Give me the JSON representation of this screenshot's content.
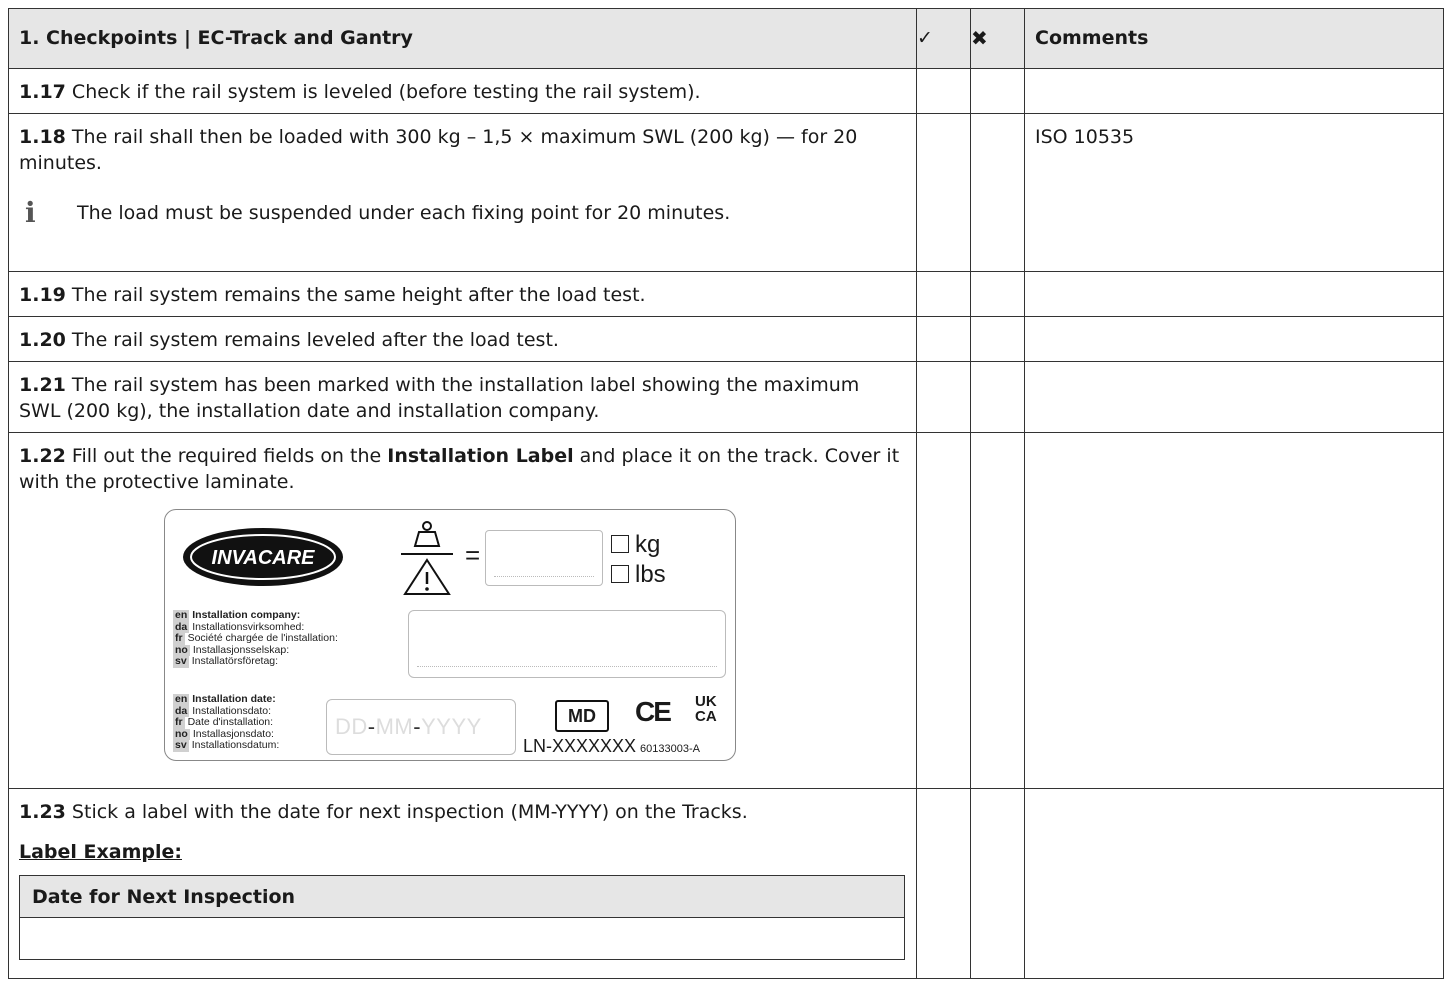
{
  "header": {
    "title": "1. Checkpoints | EC-Track and Gantry",
    "check_symbol": "✓",
    "cross_symbol": "✖",
    "comments": "Comments"
  },
  "rows": [
    {
      "num": "1.17",
      "text": " Check if the rail system is leveled (before testing the rail system).",
      "comment": ""
    },
    {
      "num": "1.18",
      "text": " The rail shall then be loaded with 300 kg – 1,5 × maximum SWL (200 kg) — for 20 minutes.",
      "note": "The load must be suspended under each fixing point for 20 minutes.",
      "comment": "ISO 10535"
    },
    {
      "num": "1.19",
      "text": " The rail system remains the same height after the load test.",
      "comment": ""
    },
    {
      "num": "1.20",
      "text": " The rail system remains leveled after the load test.",
      "comment": ""
    },
    {
      "num": "1.21",
      "text": " The rail system has been marked with the installation label showing the maximum SWL (200 kg), the installation date and installation company.",
      "comment": ""
    },
    {
      "num": "1.22",
      "text_a": " Fill out the required fields on the ",
      "text_bold": "Installation Label",
      "text_b": " and place it on the track. Cover it with the protective laminate.",
      "comment": ""
    },
    {
      "num": "1.23",
      "text": " Stick a label with the date for next inspection (MM-YYYY) on the Tracks.",
      "label_example": "Label Example:",
      "example_header": "Date for Next Inspection",
      "comment": ""
    }
  ],
  "install_label": {
    "logo_text": "INVACARE",
    "units": [
      "kg",
      "lbs"
    ],
    "company_lines": [
      {
        "code": "en",
        "text": "Installation company:"
      },
      {
        "code": "da",
        "text": "Installationsvirksomhed:"
      },
      {
        "code": "fr",
        "text": "Société chargée de l'installation:"
      },
      {
        "code": "no",
        "text": "Installasjonsselskap:"
      },
      {
        "code": "sv",
        "text": "Installatörsföretag:"
      }
    ],
    "date_lines": [
      {
        "code": "en",
        "text": "Installation date:"
      },
      {
        "code": "da",
        "text": "Installationsdato:"
      },
      {
        "code": "fr",
        "text": "Date d'installation:"
      },
      {
        "code": "no",
        "text": "Installasjonsdato:"
      },
      {
        "code": "sv",
        "text": "Installationsdatum:"
      }
    ],
    "date_placeholder_dd": "DD",
    "date_placeholder_mm": "MM",
    "date_placeholder_yyyy": "YYYY",
    "date_sep": "-",
    "md": "MD",
    "ce": "CE",
    "uk": "UK",
    "ca": "CA",
    "ln": "LN-XXXXXXX",
    "ref": "60133003-A"
  }
}
